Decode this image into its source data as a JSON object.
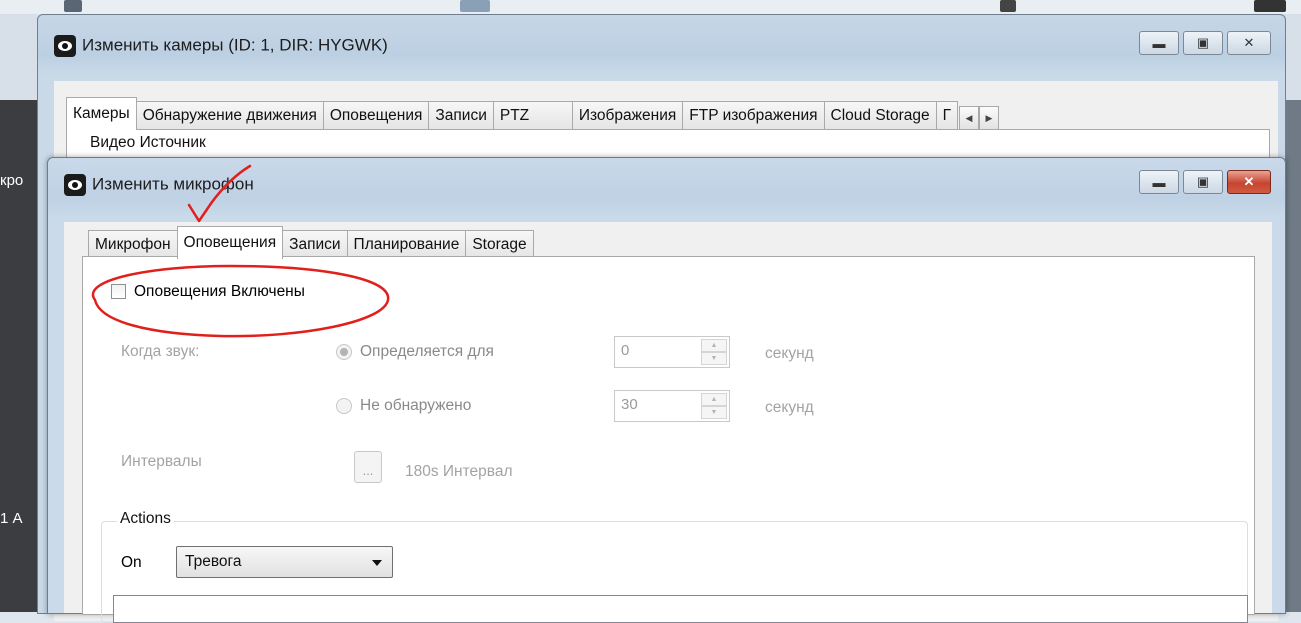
{
  "back_window": {
    "title": "Изменить камеры (ID: 1, DIR: HYGWK)",
    "tabs": [
      "Камеры",
      "Обнаружение движения",
      "Оповещения",
      "Записи",
      "PTZ",
      "Изображения",
      "FTP изображения",
      "Cloud Storage",
      "Г"
    ],
    "group_label": "Видео Источник"
  },
  "desktop": {
    "left_text_top": "кро",
    "left_text_bottom": "1 А"
  },
  "front_window": {
    "title": "Изменить микрофон",
    "tabs": [
      "Микрофон",
      "Оповещения",
      "Записи",
      "Планирование",
      "Storage"
    ],
    "active_tab": "Оповещения",
    "alerts_enabled_label": "Оповещения Включены",
    "when_sound_label": "Когда звук:",
    "detected_for_label": "Определяется для",
    "detected_for_value": "0",
    "not_detected_label": "Не обнаружено",
    "not_detected_value": "30",
    "seconds_label": "секунд",
    "intervals_label": "Интервалы",
    "intervals_button": "...",
    "intervals_value": "180s Интервал",
    "actions_group_label": "Actions",
    "on_label": "On",
    "on_select_value": "Тревога"
  },
  "colors": {
    "annotation_red": "#e0201c"
  }
}
